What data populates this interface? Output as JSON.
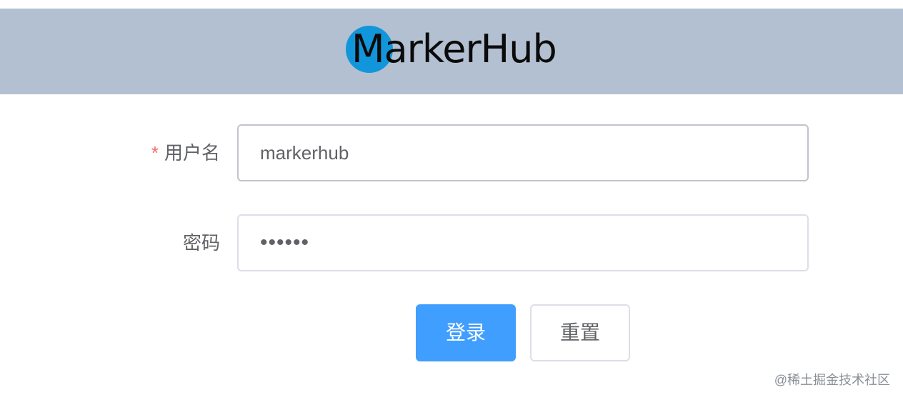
{
  "header": {
    "logo_text": "MarkerHub",
    "background_color": "#b3c0d1",
    "logo_circle_color": "#1296db"
  },
  "form": {
    "username": {
      "required_mark": "*",
      "label": "用户名",
      "value": "markerhub"
    },
    "password": {
      "label": "密码",
      "value": "••••••"
    }
  },
  "buttons": {
    "login_label": "登录",
    "reset_label": "重置",
    "primary_color": "#409eff"
  },
  "watermark": {
    "text": "@稀土掘金技术社区"
  }
}
